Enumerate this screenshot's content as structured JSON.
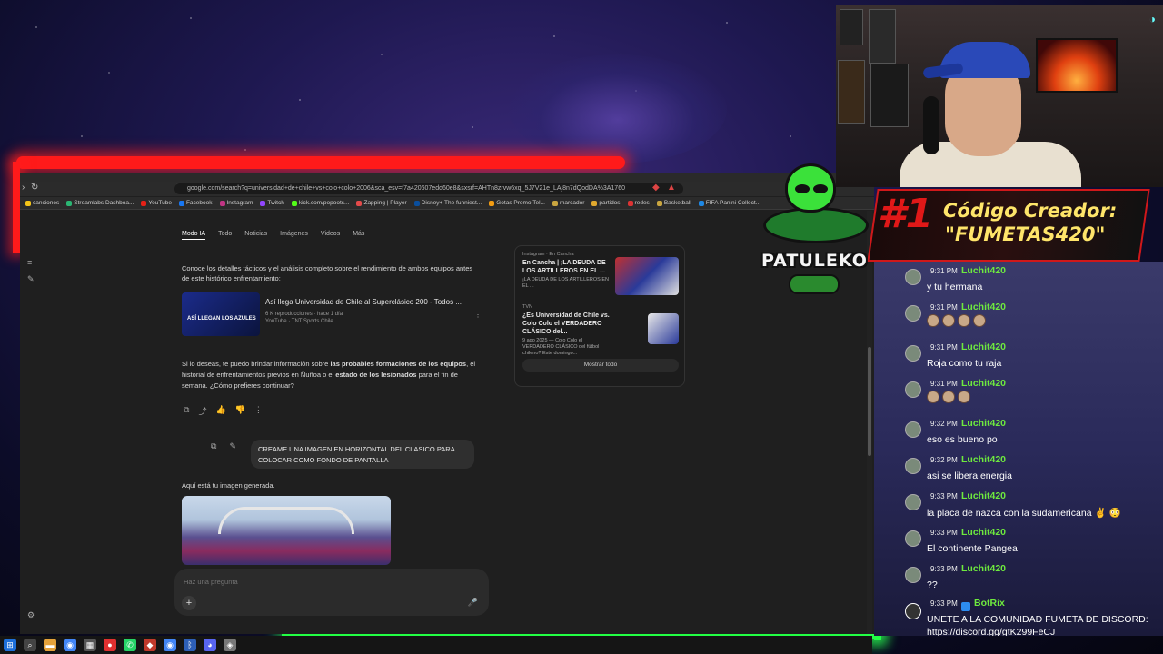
{
  "browser": {
    "url": "google.com/search?q=universidad+de+chile+vs+colo+colo+2006&sca_esv=f7a420607edd60e8&sxsrf=AHTn8zrvw6xq_5J7V21e_LAj8n7dQodDA%3A1760",
    "bookmarks": [
      "canciones",
      "Streamlabs Dashboa...",
      "YouTube",
      "Facebook",
      "Instagram",
      "Twitch",
      "kick.com/popoots...",
      "Zapping | Player",
      "Disney+ The funniest...",
      "Gotas Promo Tel...",
      "marcador",
      "partidos",
      "redes",
      "Basketball",
      "FIFA Panini Collect..."
    ],
    "tabs": [
      "Modo IA",
      "Todo",
      "Noticias",
      "Imágenes",
      "Videos",
      "Más"
    ],
    "intro_text": "Conoce los detalles tácticos y el análisis completo sobre el rendimiento de ambos equipos antes de este histórico enfrentamiento:",
    "video": {
      "title": "Así llega Universidad de Chile al Superclásico 200 - Todos ...",
      "meta1": "6 K reproducciones · hace 1 día",
      "meta2": "YouTube · TNT Sports Chile",
      "thumb_label": "ASÍ LLEGAN LOS AZULES"
    },
    "followup_text_a": "Si lo deseas, te puedo brindar información sobre ",
    "followup_bold_1": "las probables formaciones de los equipos",
    "followup_text_b": ", el historial de enfrentamientos previos en Ñuñoa o el ",
    "followup_bold_2": "estado de los lesionados",
    "followup_text_c": " para el fin de semana. ¿Cómo prefieres continuar?",
    "user_prompt": "CREAME UNA IMAGEN EN HORIZONTAL DEL CLASICO PARA COLOCAR COMO FONDO DE PANTALLA",
    "generated_label": "Aquí está tu imagen generada.",
    "cards": [
      {
        "source": "Instagram · En Cancha",
        "title": "En Cancha | ¡LA DEUDA DE LOS ARTILLEROS EN EL ...",
        "desc": "¡LA DEUDA DE LOS ARTILLEROS EN EL ..."
      },
      {
        "source": "TVN",
        "title": "¿Es Universidad de Chile vs. Colo Colo el VERDADERO CLÁSICO del...",
        "desc": "9 ago 2025 — Colo Colo el VERDADERO CLÁSICO del fútbol chileno? Este domingo..."
      }
    ],
    "show_all": "Mostrar todo",
    "ask_placeholder": "Haz una pregunta"
  },
  "overlay": {
    "code_rank": "#1",
    "code_line1": "Código Creador:",
    "code_line2": "\"FUMETAS420\"",
    "logo_name": "PATULEKO"
  },
  "chat": [
    {
      "time": "9:31 PM",
      "user": "Luchit420",
      "text": "y tu hermana"
    },
    {
      "time": "9:31 PM",
      "user": "Luchit420",
      "text": "",
      "emotes": 4
    },
    {
      "time": "9:31 PM",
      "user": "Luchit420",
      "text": "Roja como tu raja"
    },
    {
      "time": "9:31 PM",
      "user": "Luchit420",
      "text": "",
      "emotes": 3
    },
    {
      "time": "9:32 PM",
      "user": "Luchit420",
      "text": "eso es bueno po"
    },
    {
      "time": "9:32 PM",
      "user": "Luchit420",
      "text": "asi se libera energia"
    },
    {
      "time": "9:33 PM",
      "user": "Luchit420",
      "text": "la placa de nazca con la sudamericana ✌ 😳"
    },
    {
      "time": "9:33 PM",
      "user": "Luchit420",
      "text": "El continente Pangea"
    },
    {
      "time": "9:33 PM",
      "user": "Luchit420",
      "text": "??"
    },
    {
      "time": "9:33 PM",
      "user": "BotRix",
      "text": "UNETE A LA COMUNIDAD FUMETA DE DISCORD:",
      "text2": "https://discord.gg/gtK299FeCJ"
    }
  ],
  "colors": {
    "neon_red": "#ff1a1a",
    "neon_green": "#22ff44",
    "chat_user": "#6eea3e",
    "code_text": "#ffe56a"
  }
}
